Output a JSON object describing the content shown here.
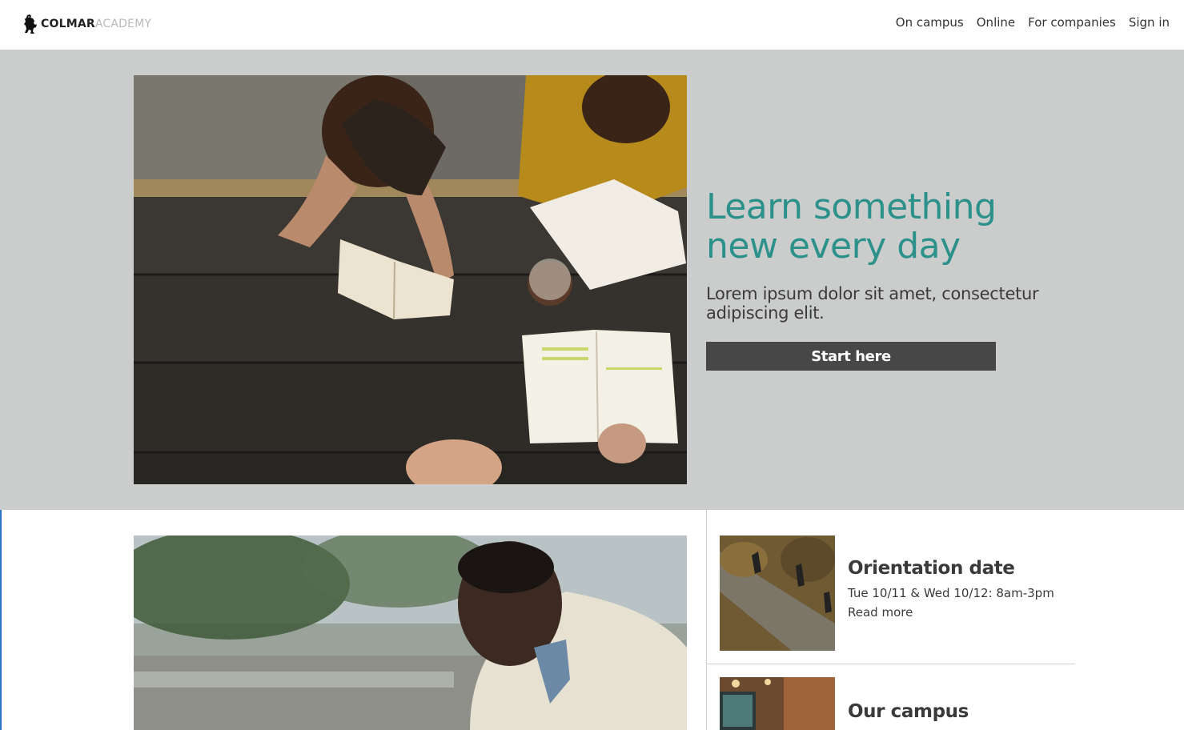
{
  "brand": {
    "name_primary": "COLMAR",
    "name_secondary": "ACADEMY",
    "icon": "lion-rampant-icon"
  },
  "nav": {
    "items": [
      {
        "label": "On campus"
      },
      {
        "label": "Online"
      },
      {
        "label": "For companies"
      },
      {
        "label": "Sign in"
      }
    ]
  },
  "hero": {
    "title": "Learn something new every day",
    "subtitle": "Lorem ipsum dolor sit amet, consectetur adipiscing elit.",
    "cta_label": "Start here",
    "background_color": "#cbcdcc",
    "title_color": "#2b918a",
    "button_color": "#474747"
  },
  "cards": [
    {
      "title": "Orientation date",
      "meta": "Tue 10/11 & Wed 10/12: 8am-3pm",
      "link": "Read more"
    },
    {
      "title": "Our campus"
    }
  ]
}
